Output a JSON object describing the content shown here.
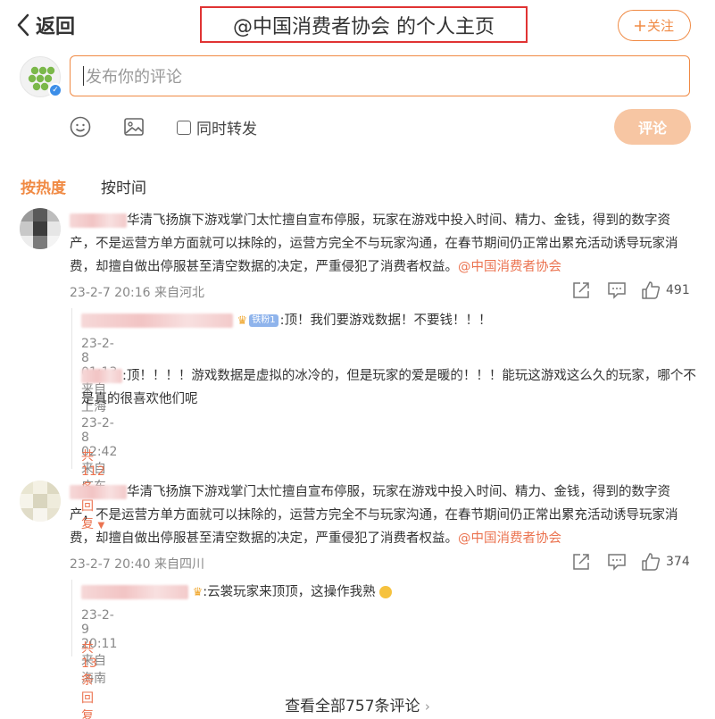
{
  "header": {
    "back_label": "返回",
    "title": "@中国消费者协会 的个人主页",
    "follow_label": "关注"
  },
  "composer": {
    "placeholder": "发布你的评论",
    "repost_label": "同时转发",
    "submit_label": "评论"
  },
  "sort": {
    "hot": "按热度",
    "time": "按时间"
  },
  "comments": [
    {
      "text": "华清飞扬旗下游戏掌门太忙擅自宣布停服，玩家在游戏中投入时间、精力、金钱，得到的数字资产，不是运营方单方面就可以抹除的，运营方完全不与玩家沟通，在春节期间仍正常出累充活动诱导玩家消费，却擅自做出停服甚至清空数据的决定，严重侵犯了消费者权益。",
      "mention": "@中国消费者协会",
      "time": "23-2-7 20:16",
      "location": "来自河北",
      "likes": "491",
      "replies": [
        {
          "badge": "铁粉1",
          "text": ":顶！我们要游戏数据！不要钱！！！",
          "time": "23-2-8 01:13",
          "location": "来自上海"
        },
        {
          "text": ":顶！！！！游戏数据是虚拟的冰冷的，但是玩家的爱是暖的！！！能玩这游戏这么久的玩家，哪个不是真的很喜欢他们呢",
          "time": "23-2-8 02:42",
          "location": "来自广东"
        }
      ],
      "more_replies": "共112条回复"
    },
    {
      "text": "华清飞扬旗下游戏掌门太忙擅自宣布停服，玩家在游戏中投入时间、精力、金钱，得到的数字资产，不是运营方单方面就可以抹除的，运营方完全不与玩家沟通，在春节期间仍正常出累充活动诱导玩家消费，却擅自做出停服甚至清空数据的决定，严重侵犯了消费者权益。",
      "mention": "@中国消费者协会",
      "time": "23-2-7 20:40",
      "location": "来自四川",
      "likes": "374",
      "replies": [
        {
          "text": ":云裳玩家来顶顶，这操作我熟",
          "time": "23-2-9 20:11",
          "location": "来自海南"
        }
      ],
      "more_replies": "共13条回复"
    }
  ],
  "view_all": "查看全部757条评论",
  "colors": {
    "accent": "#f08a44",
    "mention": "#eb7350",
    "title_box": "#e03333",
    "submit_bg": "#f7c6a3"
  }
}
